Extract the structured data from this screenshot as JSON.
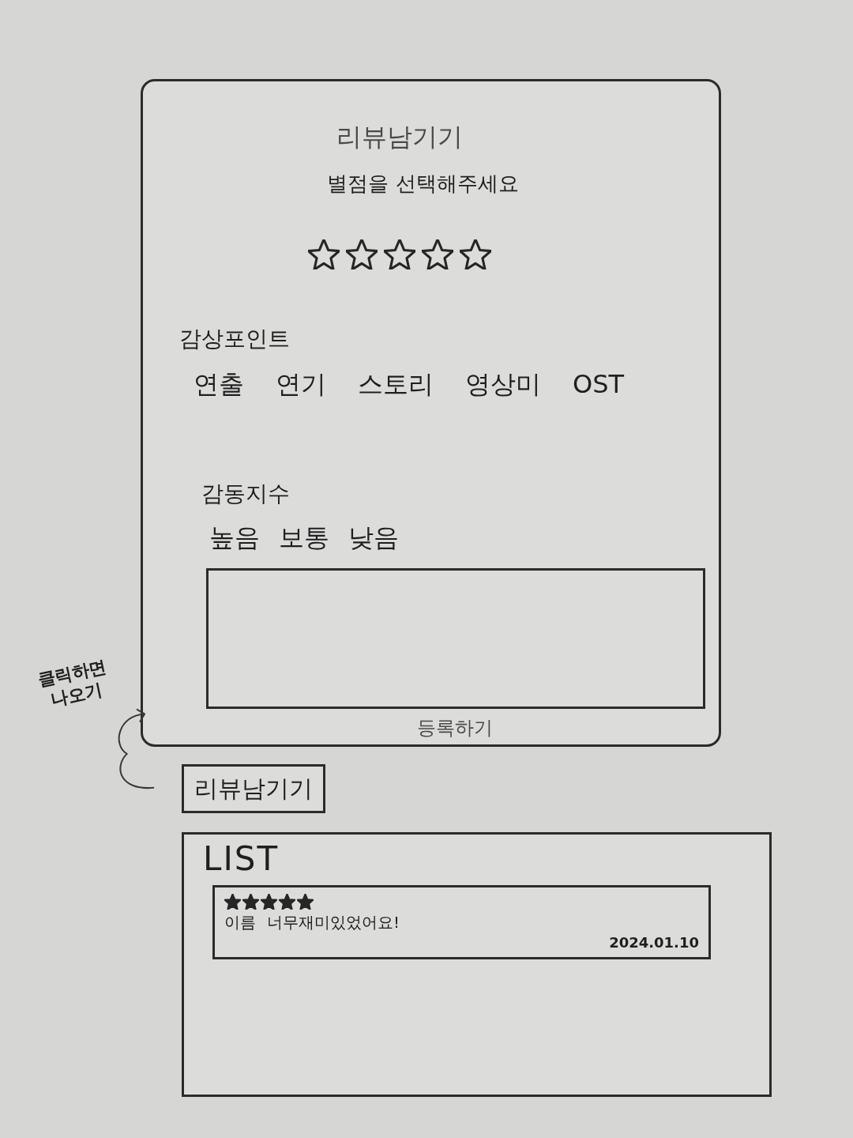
{
  "review_form": {
    "title": "리뷰남기기",
    "rating_prompt": "별점을 선택해주세요",
    "stars": 0,
    "sections": [
      {
        "heading": "감상포인트",
        "options": [
          "연출",
          "연기",
          "스토리",
          "영상미",
          "OST"
        ]
      },
      {
        "heading": "감동지수",
        "options": [
          "높음",
          "보통",
          "낮음"
        ]
      }
    ],
    "submit_button": "등록하기"
  },
  "annotation": {
    "lines": [
      "클릭하면",
      "나오기"
    ]
  },
  "open_review_button": "리뷰남기기",
  "review_list": {
    "title": "LIST",
    "items": [
      {
        "stars": 5,
        "author": "이름",
        "text": "너무재미있었어요!",
        "date": "2024.01.10"
      }
    ]
  }
}
